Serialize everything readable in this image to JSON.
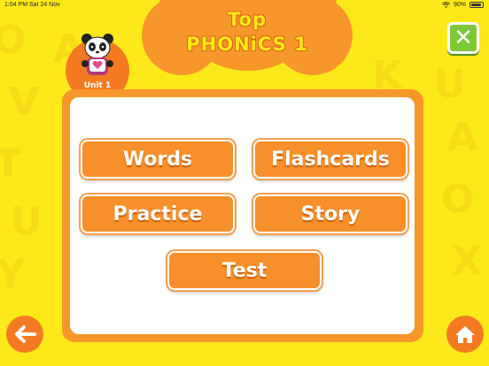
{
  "status_bar": {
    "time": "1:04 PM",
    "date": "Sat 24 Nov",
    "battery": "90%"
  },
  "header": {
    "title_line1": "Top",
    "title_line2": "PHONiCS 1"
  },
  "unit": {
    "label": "Unit 1"
  },
  "menu": {
    "words": "Words",
    "flashcards": "Flashcards",
    "practice": "Practice",
    "story": "Story",
    "test": "Test"
  },
  "icons": {
    "close": "close-icon",
    "back": "back-arrow-icon",
    "home": "home-icon"
  },
  "colors": {
    "background": "#fde81a",
    "accent_orange": "#f7902a",
    "close_green": "#7dc838"
  }
}
